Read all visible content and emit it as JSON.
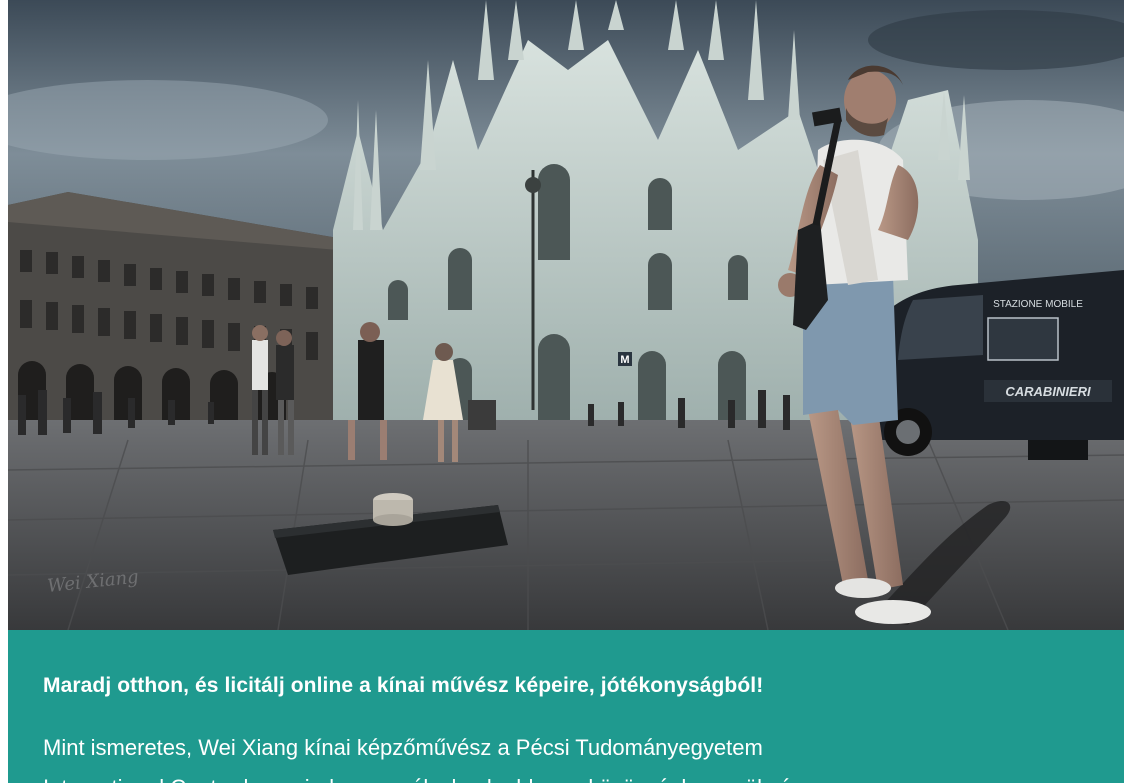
{
  "hero_image": {
    "alt": "",
    "van_labels": {
      "top": "STAZIONE MOBILE",
      "side": "CARABINIERI"
    },
    "metro_sign": "M"
  },
  "article": {
    "headline": "Maradj otthon, és licitálj online a kínai művész képeire, jótékonyságból!",
    "body_line1": "Mint ismeretes, Wei Xiang kínai képzőművész a Pécsi Tudományegyetem",
    "body_line2": "International Centre-ben mind a személyeknek ehhez a közösséghez szükséges"
  },
  "colors": {
    "accent": "#1f9a8f",
    "text": "#ffffff"
  }
}
